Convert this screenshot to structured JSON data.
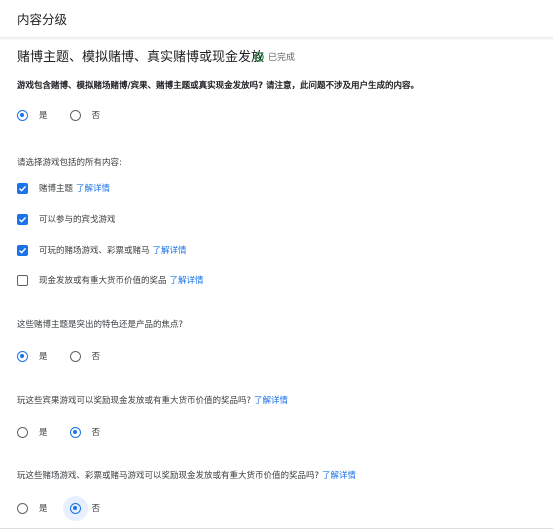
{
  "header": {
    "title": "内容分级"
  },
  "section": {
    "title": "赌博主题、模拟赌博、真实赌博或现金发放",
    "status": "已完成",
    "status_icon": "check-circle-icon"
  },
  "q1": {
    "text": "游戏包含赌博、模拟赌场赌博/宾果、赌博主题或真实现金发放吗? 请注意，此问题不涉及用户生成的内容。",
    "options": [
      "是",
      "否"
    ],
    "selected": "是"
  },
  "q2": {
    "text": "请选择游戏包括的所有内容:",
    "items": [
      {
        "label": "赌博主题",
        "link": "了解详情",
        "checked": true
      },
      {
        "label": "可以参与的宾戈游戏",
        "link": "",
        "checked": true
      },
      {
        "label": "可玩的赌场游戏、彩票或赌马",
        "link": "了解详情",
        "checked": true
      },
      {
        "label": "现金发放或有重大货币价值的奖品",
        "link": "了解详情",
        "checked": false
      }
    ]
  },
  "q3": {
    "text": "这些赌博主题是突出的特色还是产品的焦点?",
    "options": [
      "是",
      "否"
    ],
    "selected": "是"
  },
  "q4": {
    "text": "玩这些宾果游戏可以奖励现金发放或有重大货币价值的奖品吗?",
    "link": "了解详情",
    "options": [
      "是",
      "否"
    ],
    "selected": "否"
  },
  "q5": {
    "text": "玩这些赌场游戏、彩票或赌马游戏可以奖励现金发放或有重大货币价值的奖品吗?",
    "link": "了解详情",
    "options": [
      "是",
      "否"
    ],
    "selected": "否"
  },
  "colors": {
    "accent": "#1a73e8",
    "success": "#188038",
    "text": "#202124"
  }
}
